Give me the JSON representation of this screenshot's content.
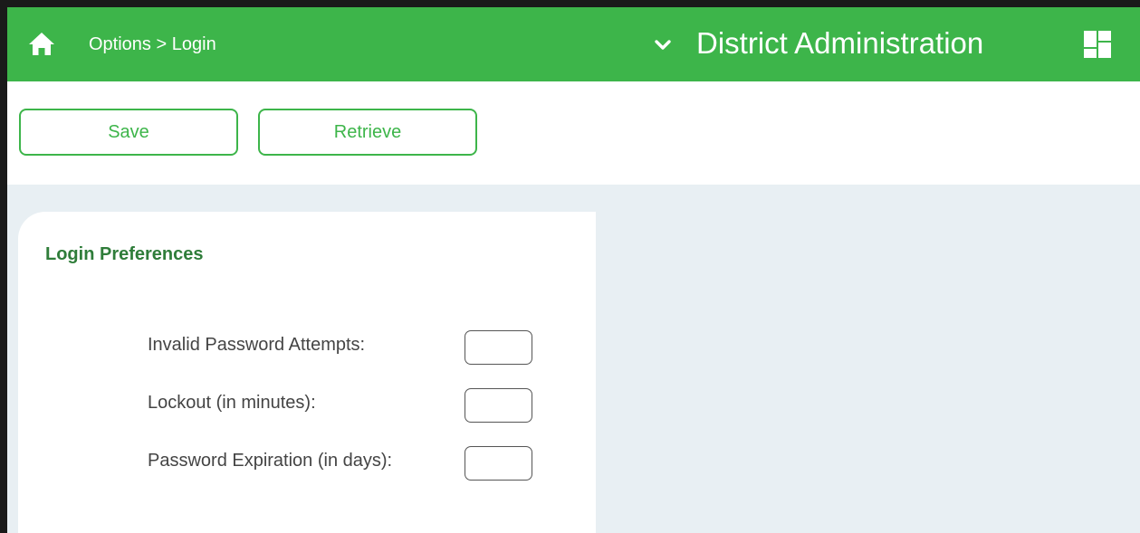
{
  "header": {
    "breadcrumb": {
      "parent": "Options",
      "separator": ">",
      "current": "Login"
    },
    "district_title": "District Administration",
    "icons": {
      "home": "home-icon",
      "chevron": "chevron-down-icon",
      "apps": "apps-grid-icon"
    },
    "background_color": "#3db54a"
  },
  "toolbar": {
    "save_label": "Save",
    "retrieve_label": "Retrieve",
    "accent_color": "#3db54a"
  },
  "login_preferences": {
    "title": "Login Preferences",
    "fields": [
      {
        "label": "Invalid Password Attempts:",
        "value": ""
      },
      {
        "label": "Lockout (in minutes):",
        "value": ""
      },
      {
        "label": "Password Expiration (in days):",
        "value": ""
      }
    ]
  },
  "content_background_color": "#e8eff3"
}
